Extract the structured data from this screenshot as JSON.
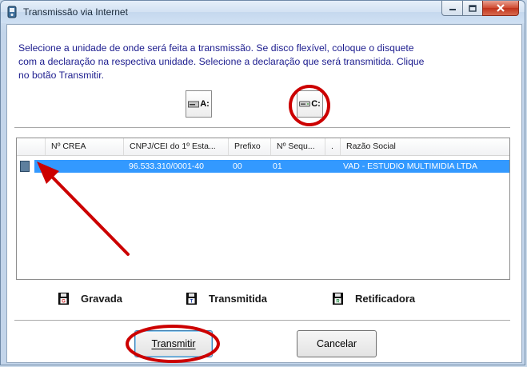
{
  "window": {
    "title": "Transmissão via Internet",
    "controls": {
      "minimize": "minimize",
      "maximize": "maximize",
      "close": "close"
    }
  },
  "instructions": "Selecione a unidade de onde será feita a transmissão. Se disco flexível, coloque o disquete com a declaração na respectiva unidade. Selecione a declaração que será transmitida. Clique no botão Transmitir.",
  "drives": [
    {
      "label": "A:",
      "icon": "floppy-drive-icon"
    },
    {
      "label": "C:",
      "icon": "hard-drive-icon",
      "highlighted": true
    }
  ],
  "list": {
    "columns": [
      "",
      "Nº CREA",
      "CNPJ/CEI do 1º Esta...",
      "Prefixo",
      "Nº Sequ...",
      ".",
      "Razão Social"
    ],
    "rows": [
      {
        "status_icon": "gravada-floppy-icon",
        "crea": "",
        "cnpj": "96.533.310/0001-40",
        "prefixo": "00",
        "sequencia": "01",
        "dot": "",
        "razao_social": "VAD - ESTUDIO MULTIMIDIA LTDA",
        "selected": true
      }
    ]
  },
  "legend": [
    {
      "label": "Gravada",
      "letter": "G",
      "color": "#cc1f1f"
    },
    {
      "label": "Transmitida",
      "letter": "T",
      "color": "#1a3fa8"
    },
    {
      "label": "Retificadora",
      "letter": "R",
      "color": "#1a8a3a"
    }
  ],
  "buttons": {
    "transmit": "Transmitir",
    "cancel": "Cancelar"
  },
  "colors": {
    "selection": "#3399ff",
    "annotation": "#cc0000",
    "instruction_text": "#1c1c8e"
  }
}
